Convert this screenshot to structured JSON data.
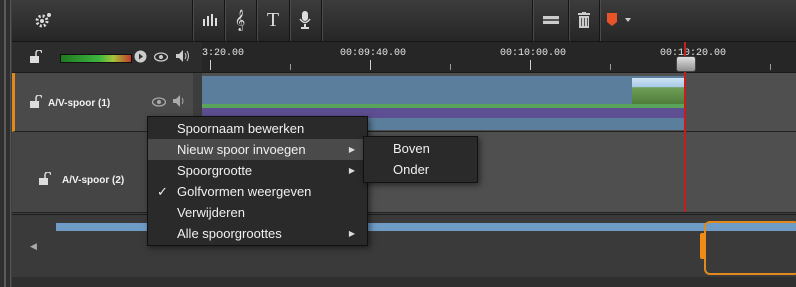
{
  "toolbar": {
    "settings_icon": "gear-icon",
    "tools": [
      {
        "name": "audio-mixer-icon",
        "glyph": "ılılı"
      },
      {
        "name": "music-icon",
        "glyph": "𝄞"
      },
      {
        "name": "text-icon",
        "glyph": "T"
      },
      {
        "name": "microphone-icon",
        "glyph": "🎙"
      }
    ],
    "right_tools": [
      {
        "name": "razor-icon",
        "glyph": "▬"
      },
      {
        "name": "trash-icon",
        "glyph": "🗑"
      },
      {
        "name": "marker-icon",
        "glyph": "▼"
      }
    ]
  },
  "ruler": {
    "labels": [
      "3:20.00",
      "00:09:40.00",
      "00:10:00.00",
      "00:10:20.00"
    ]
  },
  "tracks": [
    {
      "name": "A/V-spoor (1)",
      "selected": true
    },
    {
      "name": "A/V-spoor (2)",
      "selected": false
    }
  ],
  "context_menu": {
    "items": [
      {
        "label": "Spoornaam bewerken",
        "submenu": false,
        "checked": false,
        "highlighted": false
      },
      {
        "label": "Nieuw spoor invoegen",
        "submenu": true,
        "checked": false,
        "highlighted": true
      },
      {
        "label": "Spoorgrootte",
        "submenu": true,
        "checked": false,
        "highlighted": false
      },
      {
        "label": "Golfvormen weergeven",
        "submenu": false,
        "checked": true,
        "highlighted": false
      },
      {
        "label": "Verwijderen",
        "submenu": false,
        "checked": false,
        "highlighted": false
      },
      {
        "label": "Alle spoorgroottes",
        "submenu": true,
        "checked": false,
        "highlighted": false
      }
    ]
  },
  "submenu": {
    "items": [
      {
        "label": "Boven"
      },
      {
        "label": "Onder"
      }
    ]
  },
  "colors": {
    "accent": "#e08a1d",
    "playhead": "#c41e1e",
    "clip": "#5b7e9c"
  }
}
